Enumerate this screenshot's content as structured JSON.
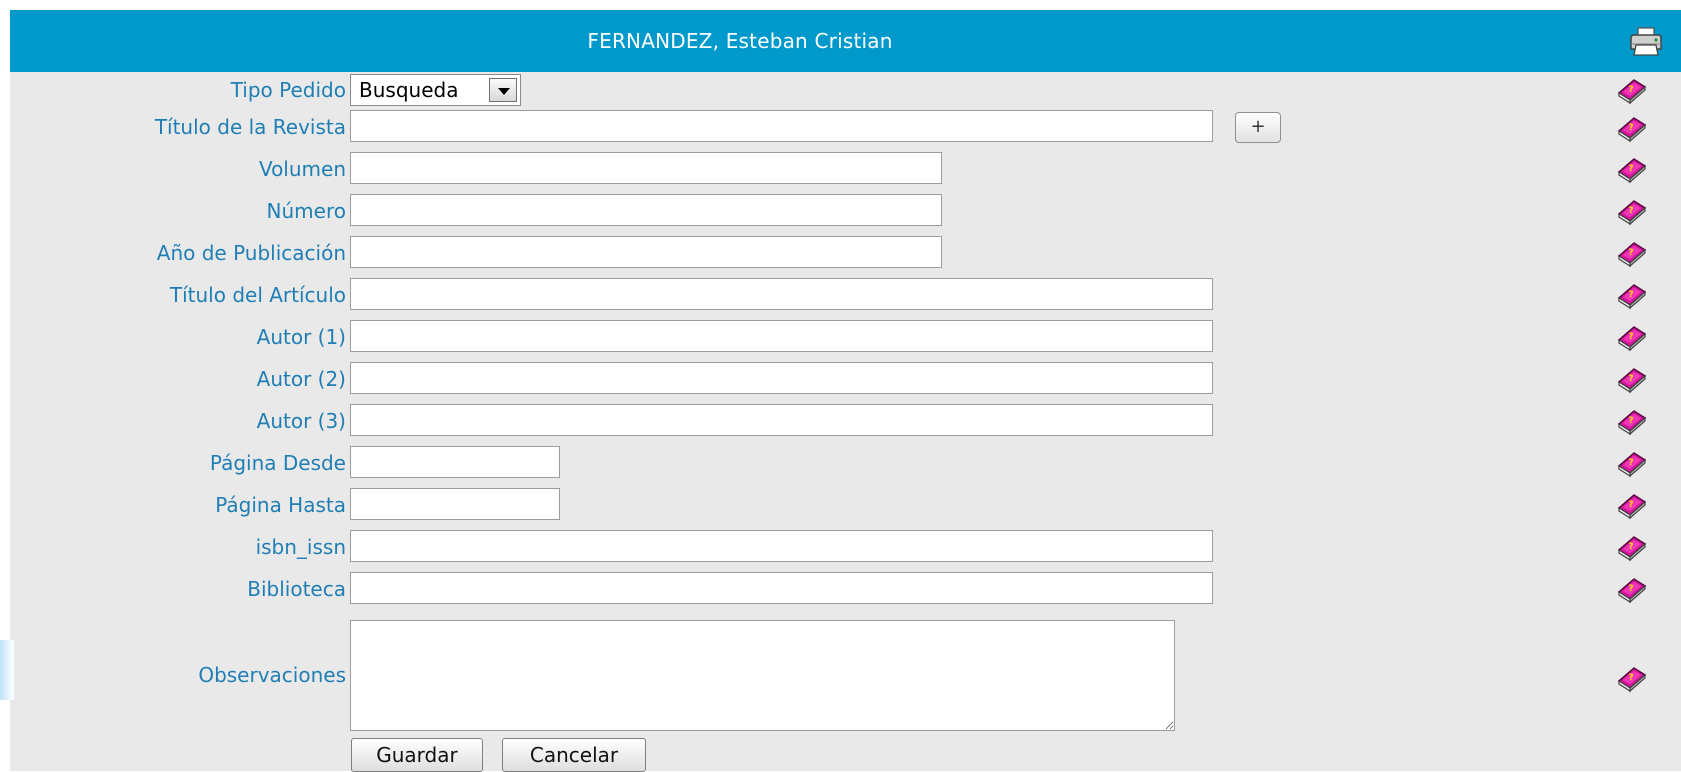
{
  "header": {
    "title": "FERNANDEZ, Esteban Cristian",
    "print_icon": "printer-icon"
  },
  "colors": {
    "header_bg": "#0099cc",
    "label": "#1f7fb5",
    "panel_bg": "#e9e9e9",
    "help_icon": "#b5179e"
  },
  "form": {
    "tipo_pedido": {
      "label": "Tipo Pedido",
      "value": "Busqueda"
    },
    "titulo_revista": {
      "label": "Título de la Revista",
      "value": "",
      "add_label": "+"
    },
    "volumen": {
      "label": "Volumen",
      "value": ""
    },
    "numero": {
      "label": "Número",
      "value": ""
    },
    "anio_publicacion": {
      "label": "Año de Publicación",
      "value": ""
    },
    "titulo_articulo": {
      "label": "Título del Artículo",
      "value": ""
    },
    "autor_1": {
      "label": "Autor (1)",
      "value": ""
    },
    "autor_2": {
      "label": "Autor (2)",
      "value": ""
    },
    "autor_3": {
      "label": "Autor (3)",
      "value": ""
    },
    "pagina_desde": {
      "label": "Página Desde",
      "value": ""
    },
    "pagina_hasta": {
      "label": "Página Hasta",
      "value": ""
    },
    "isbn_issn": {
      "label": "isbn_issn",
      "value": ""
    },
    "biblioteca": {
      "label": "Biblioteca",
      "value": ""
    },
    "observaciones": {
      "label": "Observaciones",
      "value": ""
    }
  },
  "actions": {
    "save": "Guardar",
    "cancel": "Cancelar"
  },
  "help_icon": "help-book-icon"
}
